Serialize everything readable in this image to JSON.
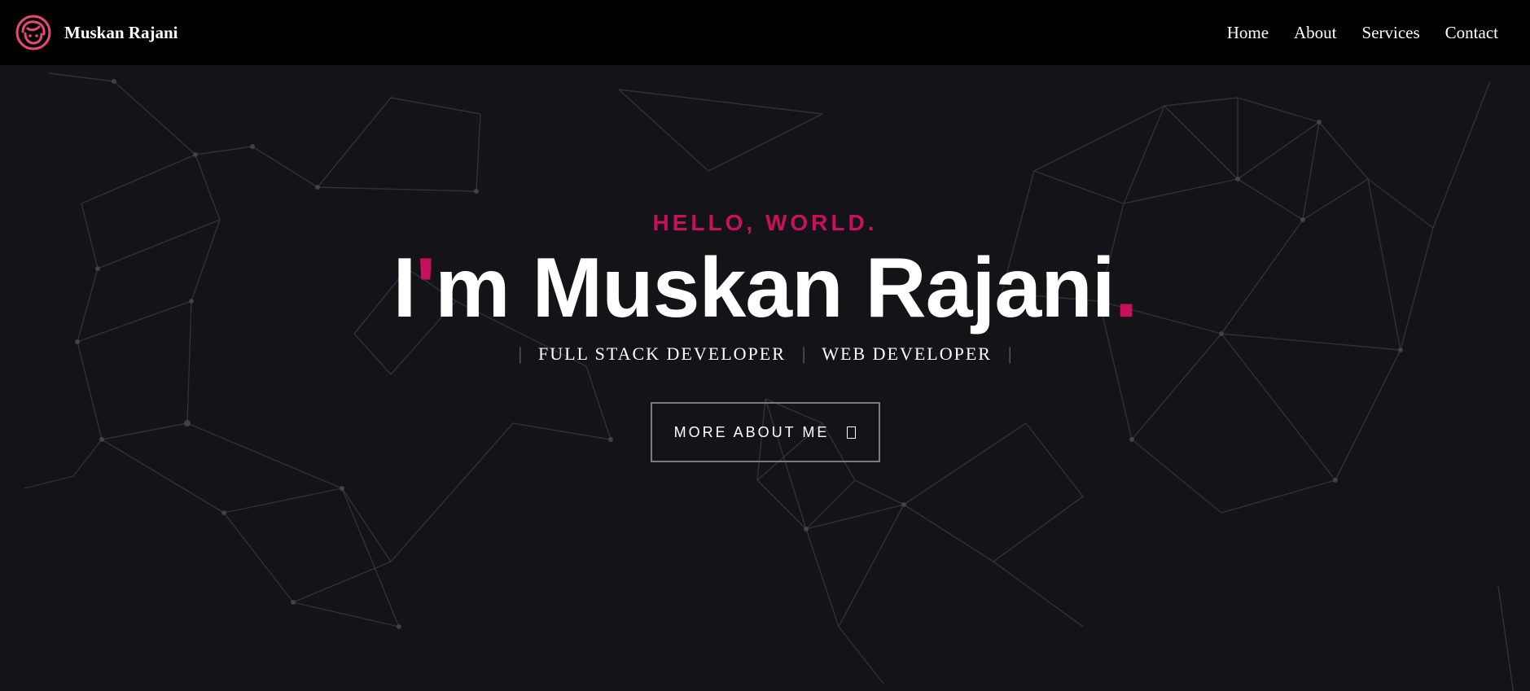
{
  "brand": {
    "name": "Muskan Rajani",
    "logo_icon": "girl-face-icon"
  },
  "nav": {
    "items": [
      {
        "label": "Home"
      },
      {
        "label": "About"
      },
      {
        "label": "Services"
      },
      {
        "label": "Contact"
      }
    ]
  },
  "hero": {
    "greeting": "HELLO, WORLD.",
    "title_prefix": "I",
    "title_apostrophe": "'",
    "title_rest": "m Muskan Rajani",
    "title_dot": ".",
    "roles": [
      "FULL STACK DEVELOPER",
      "WEB DEVELOPER"
    ],
    "role_separator": "|",
    "cta_label": "MORE ABOUT ME",
    "cta_icon": "box-icon"
  },
  "colors": {
    "accent": "#c8105d",
    "navbar_bg": "#000000",
    "hero_bg": "#141317",
    "text": "#ffffff"
  }
}
